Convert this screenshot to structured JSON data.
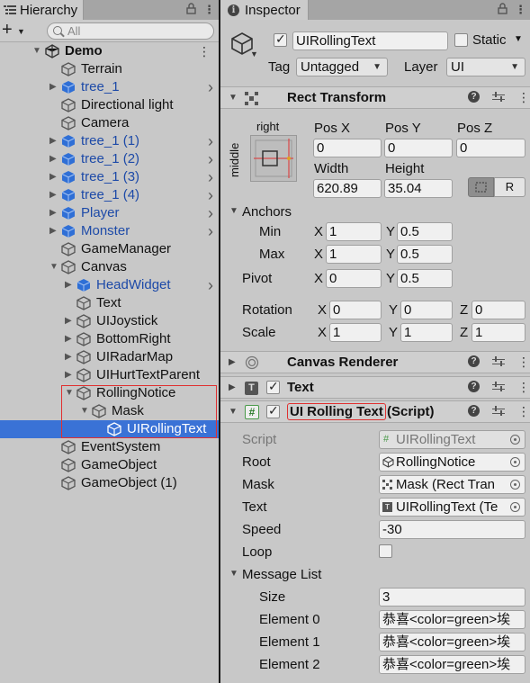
{
  "hierarchy": {
    "tab_label": "Hierarchy",
    "search_placeholder": "All",
    "scene_name": "Demo",
    "items": [
      {
        "label": "Terrain",
        "blue": false
      },
      {
        "label": "tree_1",
        "blue": true
      },
      {
        "label": "Directional light",
        "blue": false
      },
      {
        "label": "Camera",
        "blue": false
      },
      {
        "label": "tree_1 (1)",
        "blue": true
      },
      {
        "label": "tree_1 (2)",
        "blue": true
      },
      {
        "label": "tree_1 (3)",
        "blue": true
      },
      {
        "label": "tree_1 (4)",
        "blue": true
      },
      {
        "label": "Player",
        "blue": true
      },
      {
        "label": "Monster",
        "blue": true
      },
      {
        "label": "GameManager",
        "blue": false
      },
      {
        "label": "Canvas",
        "blue": false
      },
      {
        "label": "HeadWidget",
        "blue": true
      },
      {
        "label": "Text",
        "blue": false
      },
      {
        "label": "UIJoystick",
        "blue": false
      },
      {
        "label": "BottomRight",
        "blue": false
      },
      {
        "label": "UIRadarMap",
        "blue": false
      },
      {
        "label": "UIHurtTextParent",
        "blue": false
      },
      {
        "label": "RollingNotice",
        "blue": false
      },
      {
        "label": "Mask",
        "blue": false
      },
      {
        "label": "UIRollingText",
        "blue": false
      },
      {
        "label": "EventSystem",
        "blue": false
      },
      {
        "label": "GameObject",
        "blue": false
      },
      {
        "label": "GameObject (1)",
        "blue": false
      }
    ]
  },
  "inspector": {
    "tab_label": "Inspector",
    "object_name": "UIRollingText",
    "static_label": "Static",
    "tag_label": "Tag",
    "tag_value": "Untagged",
    "layer_label": "Layer",
    "layer_value": "UI",
    "rect_transform": {
      "title": "Rect Transform",
      "anchor_preset_top": "right",
      "anchor_preset_side": "middle",
      "pos_x_label": "Pos X",
      "pos_x": "0",
      "pos_y_label": "Pos Y",
      "pos_y": "0",
      "pos_z_label": "Pos Z",
      "pos_z": "0",
      "width_label": "Width",
      "width": "620.89",
      "height_label": "Height",
      "height": "35.04",
      "r_button": "R",
      "anchors_label": "Anchors",
      "min_label": "Min",
      "min_x": "1",
      "min_y": "0.5",
      "max_label": "Max",
      "max_x": "1",
      "max_y": "0.5",
      "pivot_label": "Pivot",
      "pivot_x": "0",
      "pivot_y": "0.5",
      "rotation_label": "Rotation",
      "rot_x": "0",
      "rot_y": "0",
      "rot_z": "0",
      "scale_label": "Scale",
      "scale_x": "1",
      "scale_y": "1",
      "scale_z": "1",
      "x": "X",
      "y": "Y",
      "z": "Z"
    },
    "canvas_renderer": {
      "title": "Canvas Renderer"
    },
    "text_component": {
      "title": "Text"
    },
    "script_component": {
      "title_highlight": "UI Rolling Text",
      "title_suffix": "(Script)",
      "script_label": "Script",
      "script_value": "UIRollingText",
      "root_label": "Root",
      "root_value": "RollingNotice",
      "mask_label": "Mask",
      "mask_value": "Mask (Rect Tran",
      "text_label": "Text",
      "text_value": "UIRollingText (Te",
      "speed_label": "Speed",
      "speed_value": "-30",
      "loop_label": "Loop",
      "message_list_label": "Message List",
      "size_label": "Size",
      "size_value": "3",
      "elements": [
        {
          "label": "Element 0",
          "value": "恭喜<color=green>埃"
        },
        {
          "label": "Element 1",
          "value": "恭喜<color=green>埃"
        },
        {
          "label": "Element 2",
          "value": "恭喜<color=green>埃"
        }
      ]
    }
  },
  "colors": {
    "selection": "#3a72d6",
    "prefab_blue": "#1d4aa8",
    "highlight_red": "#e03030"
  }
}
